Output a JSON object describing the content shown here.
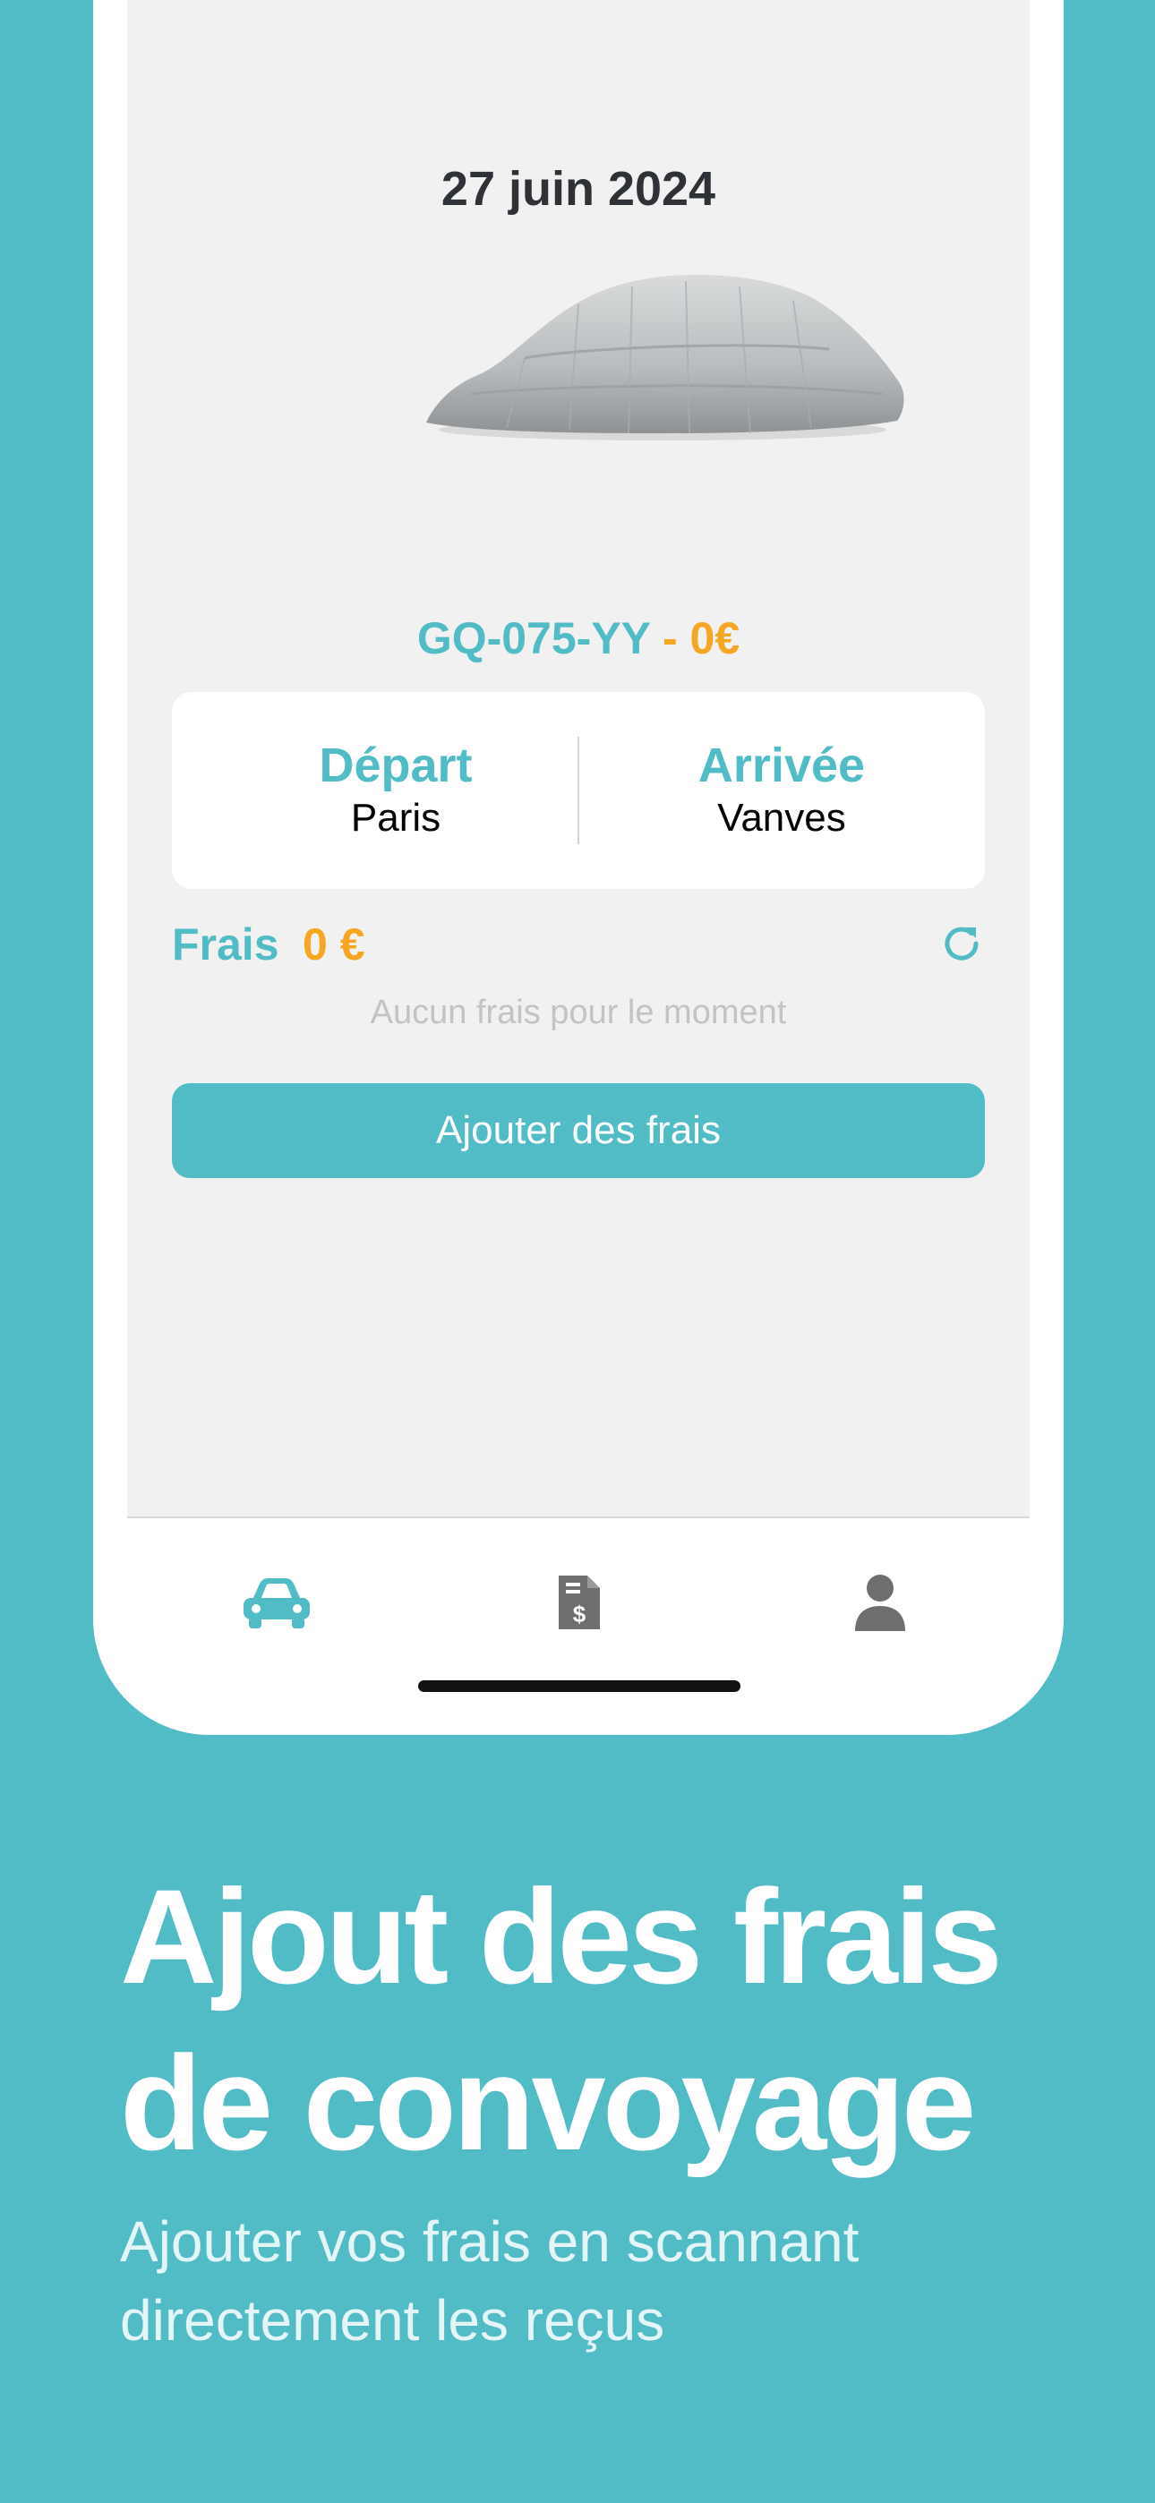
{
  "trip": {
    "date": "27 juin 2024",
    "plate": "GQ-075-YY",
    "price_suffix": " - 0€",
    "departure_label": "Départ",
    "departure_city": "Paris",
    "arrival_label": "Arrivée",
    "arrival_city": "Vanves"
  },
  "fees": {
    "label": "Frais",
    "amount": "0 €",
    "empty_message": "Aucun frais pour le moment",
    "add_button": "Ajouter des frais"
  },
  "tab_bar": {
    "items": [
      {
        "icon": "car-icon",
        "active": true
      },
      {
        "icon": "receipt-dollar-icon",
        "active": false
      },
      {
        "icon": "user-icon",
        "active": false
      }
    ]
  },
  "marketing": {
    "headline_line1": "Ajout des frais",
    "headline_line2": "de convoyage",
    "subtitle_line1": "Ajouter vos frais en scannant",
    "subtitle_line2": "directement les reçus"
  },
  "colors": {
    "accent": "#52bcc6",
    "price": "#f5a623",
    "inactive_icon": "#6e6e6e"
  }
}
